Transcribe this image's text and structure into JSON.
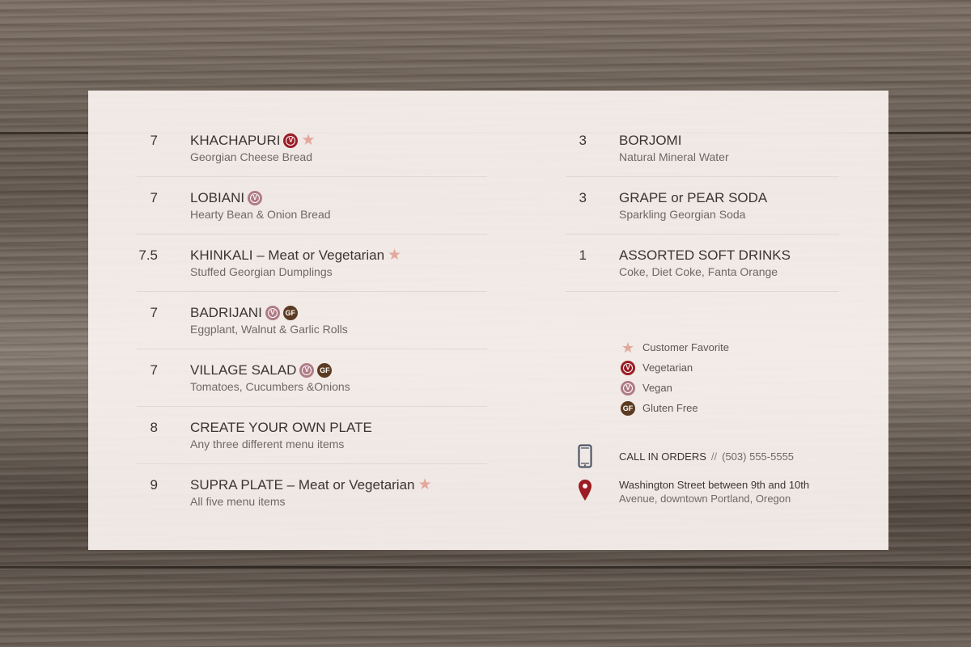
{
  "menu_left": [
    {
      "price": "7",
      "name": "KHACHAPURI",
      "tags": [
        "vegetarian",
        "favorite"
      ],
      "desc": "Georgian Cheese Bread"
    },
    {
      "price": "7",
      "name": "LOBIANI",
      "tags": [
        "vegan"
      ],
      "desc": "Hearty Bean & Onion Bread"
    },
    {
      "price": "7.5",
      "name": "KHINKALI – Meat or Vegetarian",
      "tags": [
        "favorite"
      ],
      "desc": "Stuffed Georgian Dumplings"
    },
    {
      "price": "7",
      "name": "BADRIJANI",
      "tags": [
        "vegan",
        "gluten-free"
      ],
      "desc": "Eggplant, Walnut & Garlic Rolls"
    },
    {
      "price": "7",
      "name": "VILLAGE SALAD",
      "tags": [
        "vegan",
        "gluten-free"
      ],
      "desc": "Tomatoes, Cucumbers &Onions"
    },
    {
      "price": "8",
      "name": "CREATE YOUR OWN PLATE",
      "tags": [],
      "desc": "Any three different menu items"
    },
    {
      "price": "9",
      "name": "SUPRA PLATE – Meat or Vegetarian",
      "tags": [
        "favorite"
      ],
      "desc": "All five menu items"
    }
  ],
  "menu_right": [
    {
      "price": "3",
      "name": "BORJOMI",
      "tags": [],
      "desc": "Natural Mineral Water"
    },
    {
      "price": "3",
      "name": "GRAPE or PEAR SODA",
      "tags": [],
      "desc": "Sparkling Georgian Soda"
    },
    {
      "price": "1",
      "name": "ASSORTED SOFT DRINKS",
      "tags": [],
      "desc": "Coke, Diet Coke, Fanta Orange"
    }
  ],
  "legend": [
    {
      "icon": "star-icon",
      "label": "Customer Favorite"
    },
    {
      "icon": "vegetarian-icon",
      "label": "Vegetarian"
    },
    {
      "icon": "vegan-icon",
      "label": "Vegan"
    },
    {
      "icon": "gluten-free-icon",
      "label": "Gluten Free"
    }
  ],
  "badges": {
    "vegetarian": "V",
    "vegan": "V",
    "gluten_free": "GF",
    "star": "★"
  },
  "contact": {
    "phone_label": "CALL IN ORDERS",
    "separator": "//",
    "phone": "(503) 555-5555",
    "address_line1": "Washington Street between 9th and 10th",
    "address_line2": "Avenue, downtown Portland, Oregon"
  },
  "colors": {
    "vegetarian": "#9b1c24",
    "vegan": "#b07b86",
    "gluten_free": "#5b3b22",
    "favorite_star": "#e3a79b",
    "panel": "#fbf3f0"
  }
}
